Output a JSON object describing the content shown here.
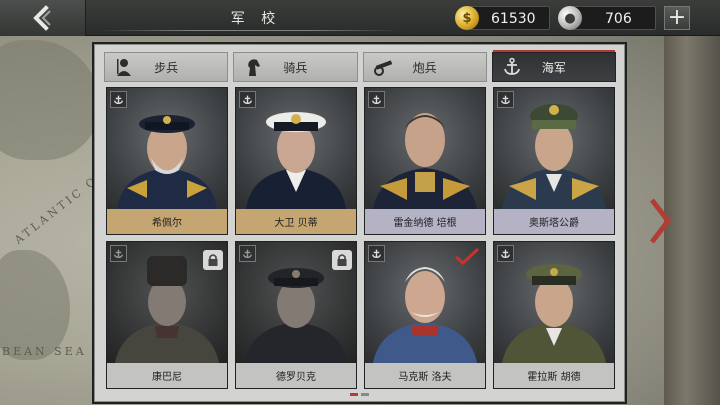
{
  "header": {
    "title": "军 校",
    "gold_amount": "61530",
    "silver_amount": "706",
    "gold_icon": "gold-coin-icon",
    "silver_icon": "silver-coin-icon"
  },
  "map": {
    "label_ocean": "ATLANTIC OC",
    "label_sea": "BEAN SEA"
  },
  "tabs": [
    {
      "label": "步兵",
      "icon": "infantry-icon",
      "active": false
    },
    {
      "label": "骑兵",
      "icon": "cavalry-icon",
      "active": false
    },
    {
      "label": "炮兵",
      "icon": "artillery-icon",
      "active": false
    },
    {
      "label": "海军",
      "icon": "anchor-icon",
      "active": true
    }
  ],
  "generals": [
    {
      "name": "希佩尔",
      "locked": false,
      "selected": false,
      "bar": "gold"
    },
    {
      "name": "大卫 贝蒂",
      "locked": false,
      "selected": false,
      "bar": "gold"
    },
    {
      "name": "雷金纳德 培根",
      "locked": false,
      "selected": false,
      "bar": "lilac"
    },
    {
      "name": "奥斯塔公爵",
      "locked": false,
      "selected": false,
      "bar": "lilac"
    },
    {
      "name": "康巴尼",
      "locked": true,
      "selected": false,
      "bar": "grey"
    },
    {
      "name": "德罗贝克",
      "locked": true,
      "selected": false,
      "bar": "grey"
    },
    {
      "name": "马克斯 洛夫",
      "locked": false,
      "selected": true,
      "bar": "grey"
    },
    {
      "name": "霍拉斯 胡德",
      "locked": false,
      "selected": false,
      "bar": "grey"
    }
  ],
  "pager": {
    "pages": 2,
    "current": 1
  },
  "colors": {
    "accent_red": "#b13a35",
    "gold_bar": "#c5a673",
    "lilac_bar": "#b5b2c6"
  }
}
